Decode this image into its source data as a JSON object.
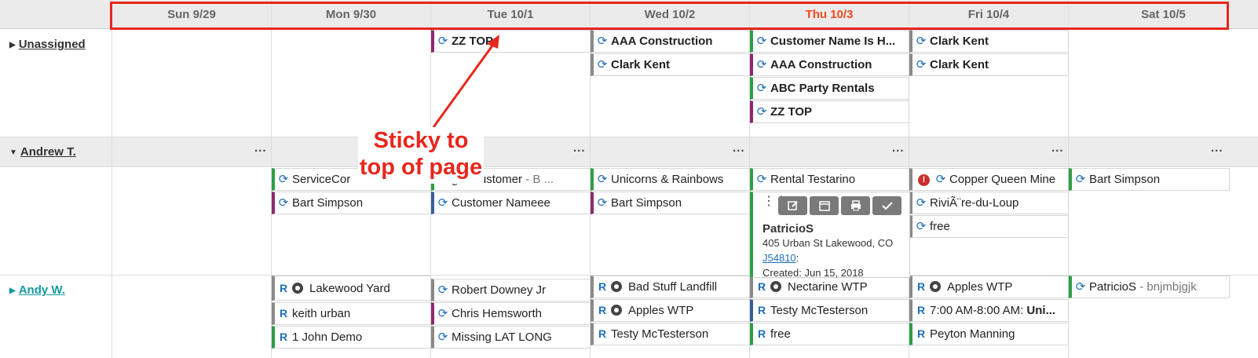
{
  "days": [
    {
      "label": "Sun 9/29",
      "today": false
    },
    {
      "label": "Mon 9/30",
      "today": false
    },
    {
      "label": "Tue 10/1",
      "today": false
    },
    {
      "label": "Wed 10/2",
      "today": false
    },
    {
      "label": "Thu 10/3",
      "today": true
    },
    {
      "label": "Fri 10/4",
      "today": false
    },
    {
      "label": "Sat 10/5",
      "today": false
    }
  ],
  "resources": {
    "unassigned": "Unassigned",
    "andrew": "Andrew T.",
    "andy": "Andy W."
  },
  "more_label": "...",
  "icons": {
    "refresh": "refresh-icon",
    "recurring": "R",
    "grip": "drag-handle-icon"
  },
  "unassigned_jobs": {
    "tue": [
      "ZZ TOP"
    ],
    "wed": [
      "AAA Construction",
      "Clark Kent"
    ],
    "thu": [
      "Customer Name Is H...",
      "AAA Construction",
      "ABC Party Rentals",
      "ZZ TOP"
    ],
    "fri": [
      "Clark Kent",
      "Clark Kent"
    ]
  },
  "andrew_jobs": {
    "mon": [
      "ServiceCor",
      "Bart Simpson"
    ],
    "tue_0_name": "get Customer",
    "tue_0_sub": " - B ...",
    "tue_1": "Customer Nameee",
    "wed": [
      "Unicorns & Rainbows",
      "Bart Simpson"
    ],
    "thu": [
      "Rental Testarino"
    ],
    "fri": [
      "Copper Queen Mine",
      "RiviÃ¨re-du-Loup",
      "free"
    ],
    "sat": [
      "Bart Simpson"
    ]
  },
  "popup": {
    "title": "PatricioS",
    "address": "405 Urban St Lakewood, CO",
    "job_link": "J54810",
    "job_link_suffix": ":",
    "created": "Created: Jun 15, 2018"
  },
  "andy_jobs": {
    "mon": [
      "Lakewood Yard",
      "keith urban",
      "1 John Demo"
    ],
    "tue": [
      "Robert Downey Jr",
      "Chris Hemsworth",
      "Missing LAT LONG"
    ],
    "wed": [
      "Bad Stuff Landfill",
      "Apples WTP",
      "Testy McTesterson"
    ],
    "thu": [
      "Nectarine WTP",
      "Testy McTesterson",
      "free"
    ],
    "fri_0": "Apples WTP",
    "fri_1_time": "7:00 AM-8:00 AM: ",
    "fri_1_name": "Uni...",
    "fri_2": "Peyton Manning",
    "sat_name": "PatricioS",
    "sat_sub": " - bnjmbjgjk"
  },
  "annotation": {
    "callout": "Sticky to top of page"
  },
  "colors": {
    "highlight": "#e8261c",
    "today": "#f24a1d",
    "accent": "#1f6fb8"
  }
}
